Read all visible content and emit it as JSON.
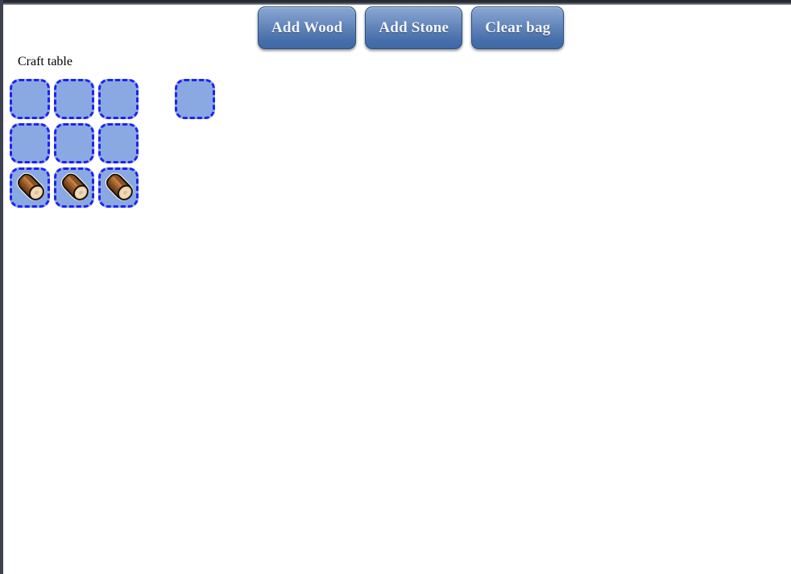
{
  "page": {
    "title": "Craft table",
    "background_color": "#ffffff",
    "left_edge_color": "#3e4250",
    "top_bar_color": "#23262e"
  },
  "toolbar": {
    "buttons": [
      {
        "label": "Add Wood",
        "name": "add-wood-button"
      },
      {
        "label": "Add Stone",
        "name": "add-stone-button"
      },
      {
        "label": "Clear bag",
        "name": "clear-bag-button"
      }
    ],
    "accent_color": "#5e82b8",
    "text_color": "#f4f6fb"
  },
  "craft": {
    "label": "Craft table",
    "slot_fill_color": "#8aa9e3",
    "slot_border_color": "#1f21f0",
    "grid": {
      "rows": 3,
      "cols": 3,
      "cells": [
        {
          "row": 0,
          "col": 0,
          "item": ""
        },
        {
          "row": 0,
          "col": 1,
          "item": ""
        },
        {
          "row": 0,
          "col": 2,
          "item": ""
        },
        {
          "row": 1,
          "col": 0,
          "item": ""
        },
        {
          "row": 1,
          "col": 1,
          "item": ""
        },
        {
          "row": 1,
          "col": 2,
          "item": ""
        },
        {
          "row": 2,
          "col": 0,
          "item": "wood-log-icon"
        },
        {
          "row": 2,
          "col": 1,
          "item": "wood-log-icon"
        },
        {
          "row": 2,
          "col": 2,
          "item": "wood-log-icon"
        }
      ]
    },
    "output_slot": {
      "item": "",
      "name": "craft-output-slot"
    }
  },
  "icons": {
    "wood_log": {
      "name": "wood-log-icon",
      "body_color": "#7a4a20",
      "highlight_color": "#a9682f",
      "cut_face_color": "#e9d2ab",
      "outline_color": "#1b1008"
    }
  }
}
